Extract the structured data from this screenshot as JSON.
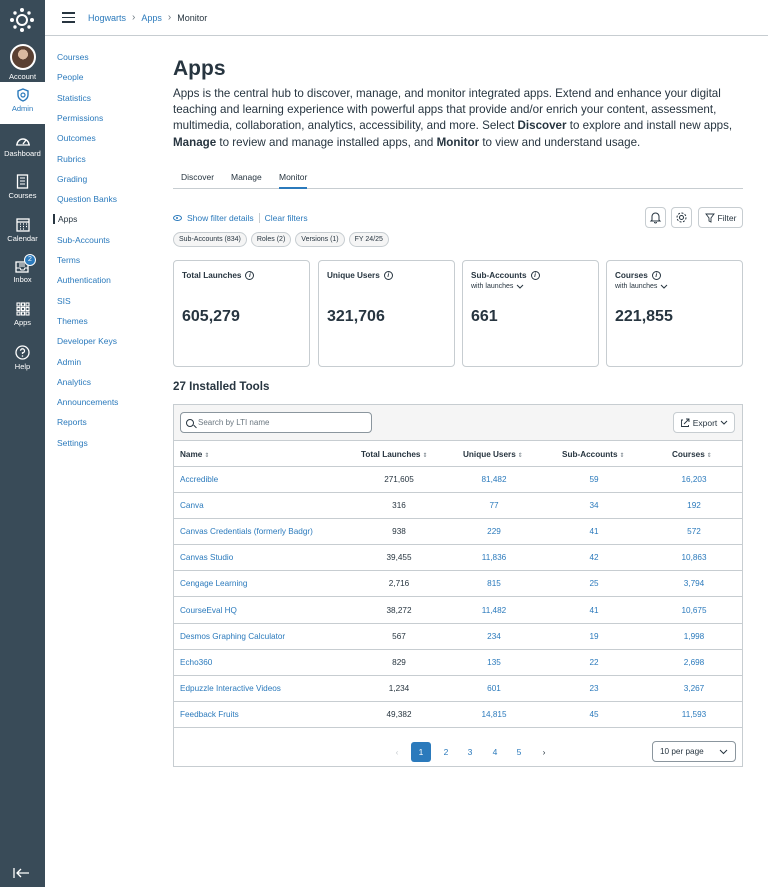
{
  "global_nav": {
    "items": [
      {
        "label": "Account"
      },
      {
        "label": "Admin"
      },
      {
        "label": "Dashboard"
      },
      {
        "label": "Courses"
      },
      {
        "label": "Calendar"
      },
      {
        "label": "Inbox",
        "badge": "2"
      },
      {
        "label": "Apps"
      },
      {
        "label": "Help"
      }
    ]
  },
  "header": {
    "breadcrumbs": [
      "Hogwarts",
      "Apps",
      "Monitor"
    ]
  },
  "account_nav": {
    "items": [
      "Courses",
      "People",
      "Statistics",
      "Permissions",
      "Outcomes",
      "Rubrics",
      "Grading",
      "Question Banks",
      "Apps",
      "Sub-Accounts",
      "Terms",
      "Authentication",
      "SIS",
      "Themes",
      "Developer Keys",
      "Admin",
      "Analytics",
      "Announcements",
      "Reports",
      "Settings"
    ],
    "active": "Apps"
  },
  "page": {
    "title": "Apps",
    "intro_1": "Apps is the central hub to discover, manage, and monitor integrated apps. Extend and enhance your digital teaching and learning experience with powerful apps that provide and/or enrich your content, assessment, multimedia, collaboration, analytics, accessibility, and more. Select ",
    "intro_b1": "Discover",
    "intro_2": " to explore and install new apps, ",
    "intro_b2": "Manage",
    "intro_3": " to review and manage installed apps, and ",
    "intro_b3": "Monitor",
    "intro_4": " to view and understand usage."
  },
  "tabs": [
    "Discover",
    "Manage",
    "Monitor"
  ],
  "filters": {
    "show_details": "Show filter details",
    "clear": "Clear filters",
    "chips": [
      "Sub-Accounts (834)",
      "Roles (2)",
      "Versions (1)",
      "FY 24/25"
    ],
    "filter_button": "Filter"
  },
  "cards": [
    {
      "title": "Total Launches",
      "sub": "",
      "value": "605,279"
    },
    {
      "title": "Unique Users",
      "sub": "",
      "value": "321,706"
    },
    {
      "title": "Sub-Accounts",
      "sub": "with launches",
      "value": "661"
    },
    {
      "title": "Courses",
      "sub": "with launches",
      "value": "221,855"
    }
  ],
  "tools": {
    "heading": "27 Installed Tools",
    "search_placeholder": "Search by LTI name",
    "export_label": "Export",
    "columns": [
      "Name",
      "Total Launches",
      "Unique Users",
      "Sub-Accounts",
      "Courses"
    ],
    "rows": [
      [
        "Accredible",
        "271,605",
        "81,482",
        "59",
        "16,203"
      ],
      [
        "Canva",
        "316",
        "77",
        "34",
        "192"
      ],
      [
        "Canvas Credentials (formerly Badgr)",
        "938",
        "229",
        "41",
        "572"
      ],
      [
        "Canvas Studio",
        "39,455",
        "11,836",
        "42",
        "10,863"
      ],
      [
        "Cengage Learning",
        "2,716",
        "815",
        "25",
        "3,794"
      ],
      [
        "CourseEval HQ",
        "38,272",
        "11,482",
        "41",
        "10,675"
      ],
      [
        "Desmos Graphing Calculator",
        "567",
        "234",
        "19",
        "1,998"
      ],
      [
        "Echo360",
        "829",
        "135",
        "22",
        "2,698"
      ],
      [
        "Edpuzzle Interactive Videos",
        "1,234",
        "601",
        "23",
        "3,267"
      ],
      [
        "Feedback Fruits",
        "49,382",
        "14,815",
        "45",
        "11,593"
      ]
    ],
    "pages": [
      "1",
      "2",
      "3",
      "4",
      "5"
    ],
    "current_page": "1",
    "per_page": "10 per page"
  },
  "colors": {
    "nav_bg": "#394b58",
    "link": "#2b7abc",
    "text": "#273540",
    "border": "#c7cdd1"
  }
}
